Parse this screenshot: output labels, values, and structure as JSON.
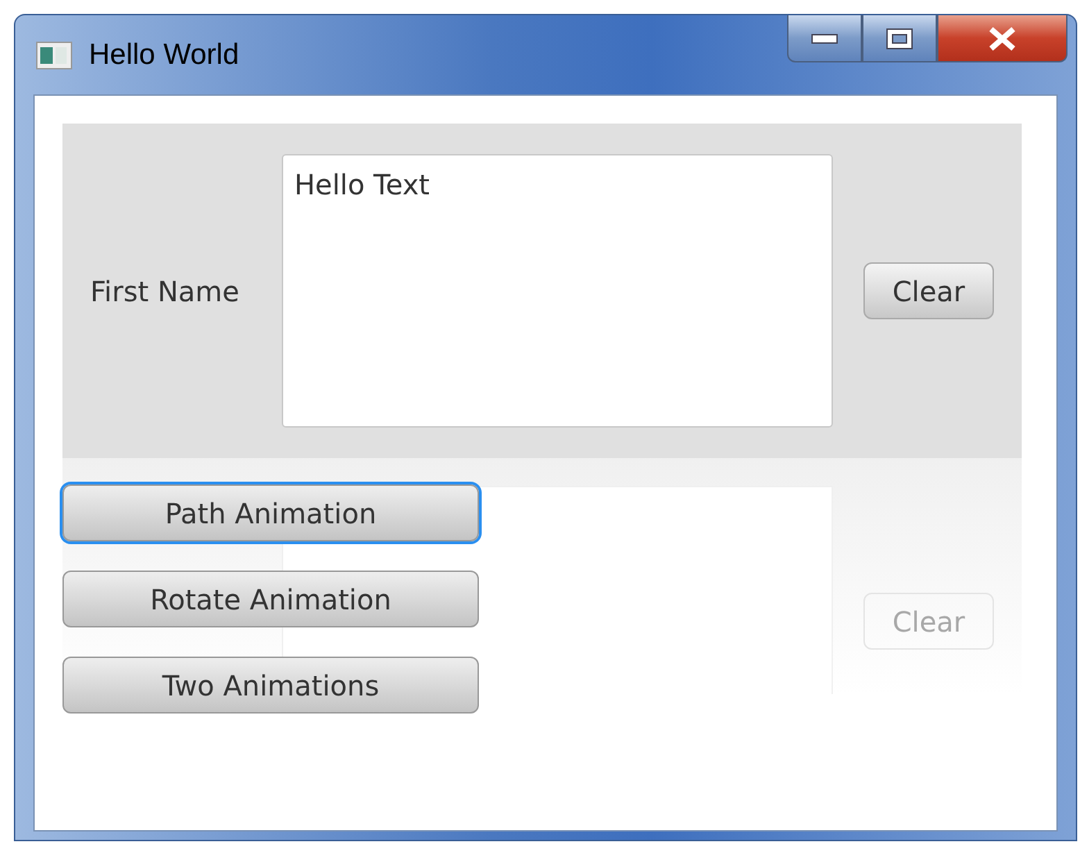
{
  "window": {
    "title": "Hello World"
  },
  "form": {
    "label": "First Name",
    "text_area": {
      "value": "Hello Text"
    },
    "clear_button": "Clear"
  },
  "reflection": {
    "clear_button": "Clear"
  },
  "buttons": [
    {
      "label": "Path Animation",
      "focused": true
    },
    {
      "label": "Rotate Animation",
      "focused": false
    },
    {
      "label": "Two Animations",
      "focused": false
    }
  ]
}
